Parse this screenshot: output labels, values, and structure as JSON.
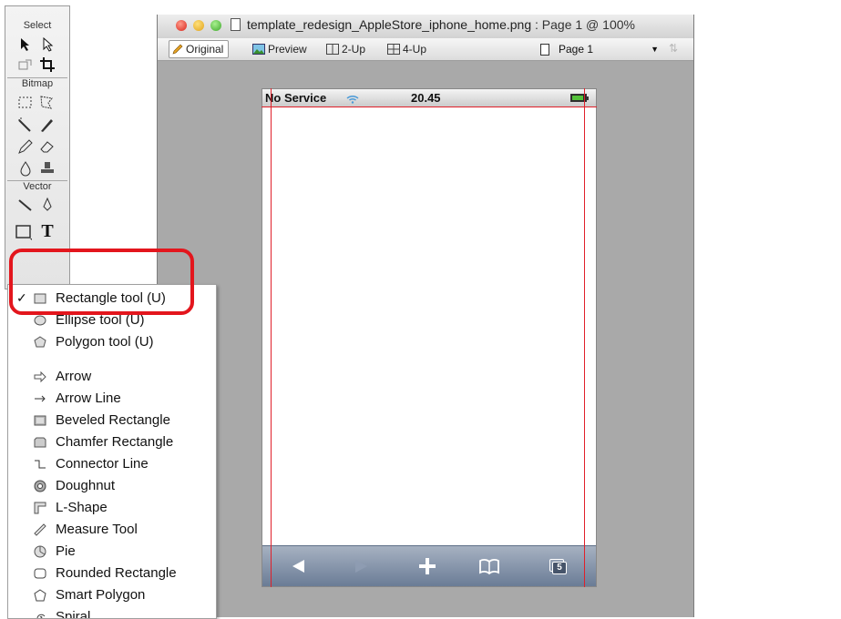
{
  "tools_panel": {
    "sections": {
      "select": "Select",
      "bitmap": "Bitmap",
      "vector": "Vector"
    },
    "text_tool_glyph": "T"
  },
  "document": {
    "title": "template_redesign_AppleStore_iphone_home.png",
    "page_info": " : Page 1 @ 100%",
    "view_tabs": [
      "Original",
      "Preview",
      "2-Up",
      "4-Up"
    ],
    "page_select": "Page 1"
  },
  "iphone": {
    "carrier": "No Service",
    "time": "20.45",
    "bottom_icons": [
      "back-arrow-icon",
      "forward-arrow-icon",
      "plus-icon",
      "bookmarks-icon",
      "pages-icon"
    ],
    "pages_count": "5"
  },
  "flyout_menu": {
    "items": [
      {
        "label": "Rectangle tool (U)",
        "icon": "rectangle-icon",
        "checked": true
      },
      {
        "label": "Ellipse tool (U)",
        "icon": "ellipse-icon"
      },
      {
        "label": "Polygon tool (U)",
        "icon": "polygon-icon"
      },
      {
        "label": "Arrow",
        "icon": "arrow-icon"
      },
      {
        "label": "Arrow Line",
        "icon": "arrow-line-icon"
      },
      {
        "label": "Beveled Rectangle",
        "icon": "beveled-rectangle-icon"
      },
      {
        "label": "Chamfer Rectangle",
        "icon": "chamfer-rectangle-icon"
      },
      {
        "label": "Connector Line",
        "icon": "connector-line-icon"
      },
      {
        "label": "Doughnut",
        "icon": "doughnut-icon"
      },
      {
        "label": "L-Shape",
        "icon": "l-shape-icon"
      },
      {
        "label": "Measure Tool",
        "icon": "measure-tool-icon"
      },
      {
        "label": "Pie",
        "icon": "pie-icon"
      },
      {
        "label": "Rounded Rectangle",
        "icon": "rounded-rectangle-icon"
      },
      {
        "label": "Smart Polygon",
        "icon": "smart-polygon-icon"
      },
      {
        "label": "Spiral",
        "icon": "spiral-icon"
      }
    ],
    "check_glyph": "✓"
  },
  "colors": {
    "highlight": "#e3161d",
    "guide": "#e0202a",
    "canvas_bg": "#a9a9a9"
  }
}
